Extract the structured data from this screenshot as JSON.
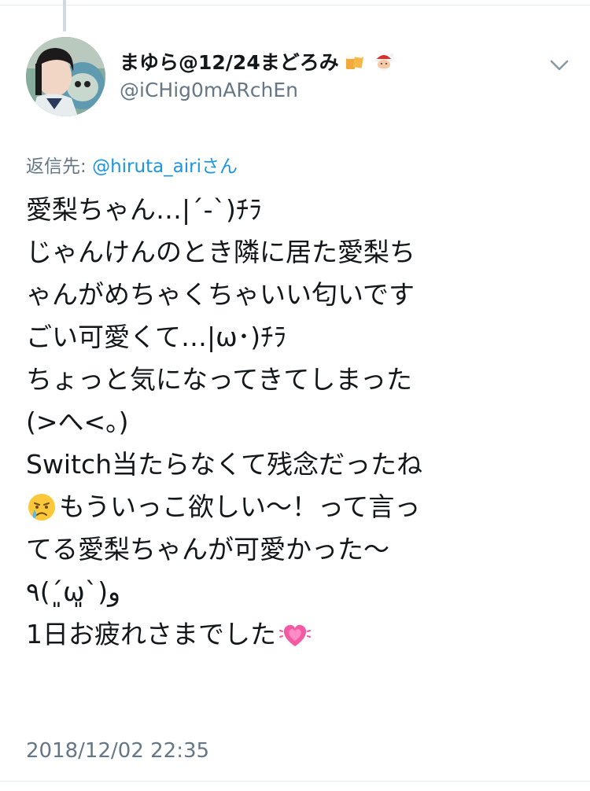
{
  "tweet": {
    "author": {
      "display_name": "まゆら@12/24まどろみ",
      "name_emojis": [
        "beer-mugs-emoji",
        "santa-emoji"
      ],
      "handle": "@iCHig0mARchEn",
      "avatar": "profile-photo"
    },
    "reply": {
      "prefix": "返信先: ",
      "target": "@hiruta_airi",
      "suffix": "さん"
    },
    "text_lines": [
      "愛梨ちゃん…|´-`)ﾁﾗ",
      "じゃんけんのとき隣に居た愛梨ち",
      "ゃんがめちゃくちゃいい匂いです",
      "ごい可愛くて…|ω･)ﾁﾗ",
      "ちょっと気になってきてしまった",
      "(>へ<。)",
      "Switch当たらなくて残念だったね",
      "もういっこ欲しい〜！って言っ",
      "てる愛梨ちゃんが可愛かった〜",
      "٩(´͈ω͈`)و",
      "1日お疲れさまでした"
    ],
    "inline_emojis": {
      "crying": "crying-face-emoji",
      "heart": "growing-heart-emoji"
    },
    "timestamp": "2018/12/02 22:35"
  },
  "colors": {
    "text": "#14171a",
    "secondary": "#657786",
    "link": "#1b95e0"
  },
  "icons": {
    "menu": "chevron-down-icon"
  }
}
